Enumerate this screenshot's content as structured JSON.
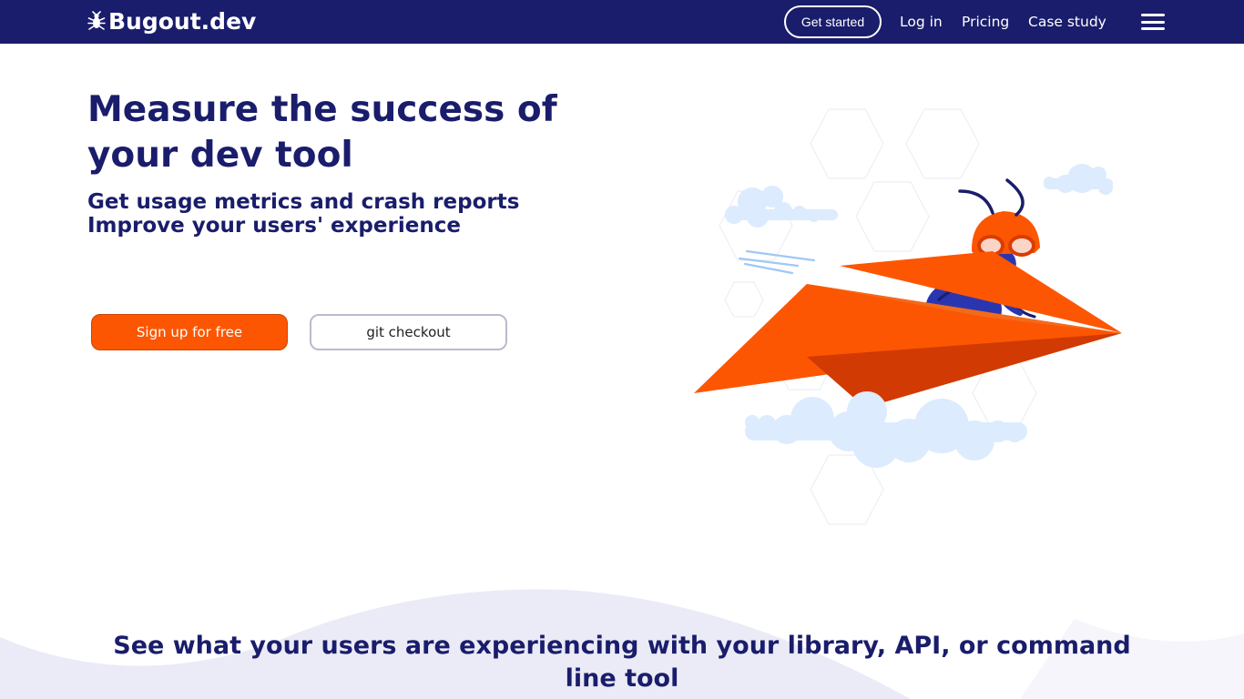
{
  "nav": {
    "brand": "Bugout.dev",
    "get_started": "Get started",
    "login": "Log in",
    "pricing": "Pricing",
    "case_study": "Case study"
  },
  "hero": {
    "title": "Measure the success of your dev tool",
    "subtitle_line1": "Get usage metrics and crash reports",
    "subtitle_line2": "Improve your users' experience",
    "signup_label": "Sign up for free",
    "git_label": "git checkout"
  },
  "section": {
    "title": "See what your users are experiencing with your library, API, or command line tool"
  },
  "colors": {
    "navy": "#1a1d6b",
    "orange": "#fd5602",
    "cloud": "#dcebfd",
    "wave": "#ebebf7"
  },
  "icons": {
    "brand_icon": "bug-icon",
    "menu_icon": "hamburger-menu-icon"
  }
}
